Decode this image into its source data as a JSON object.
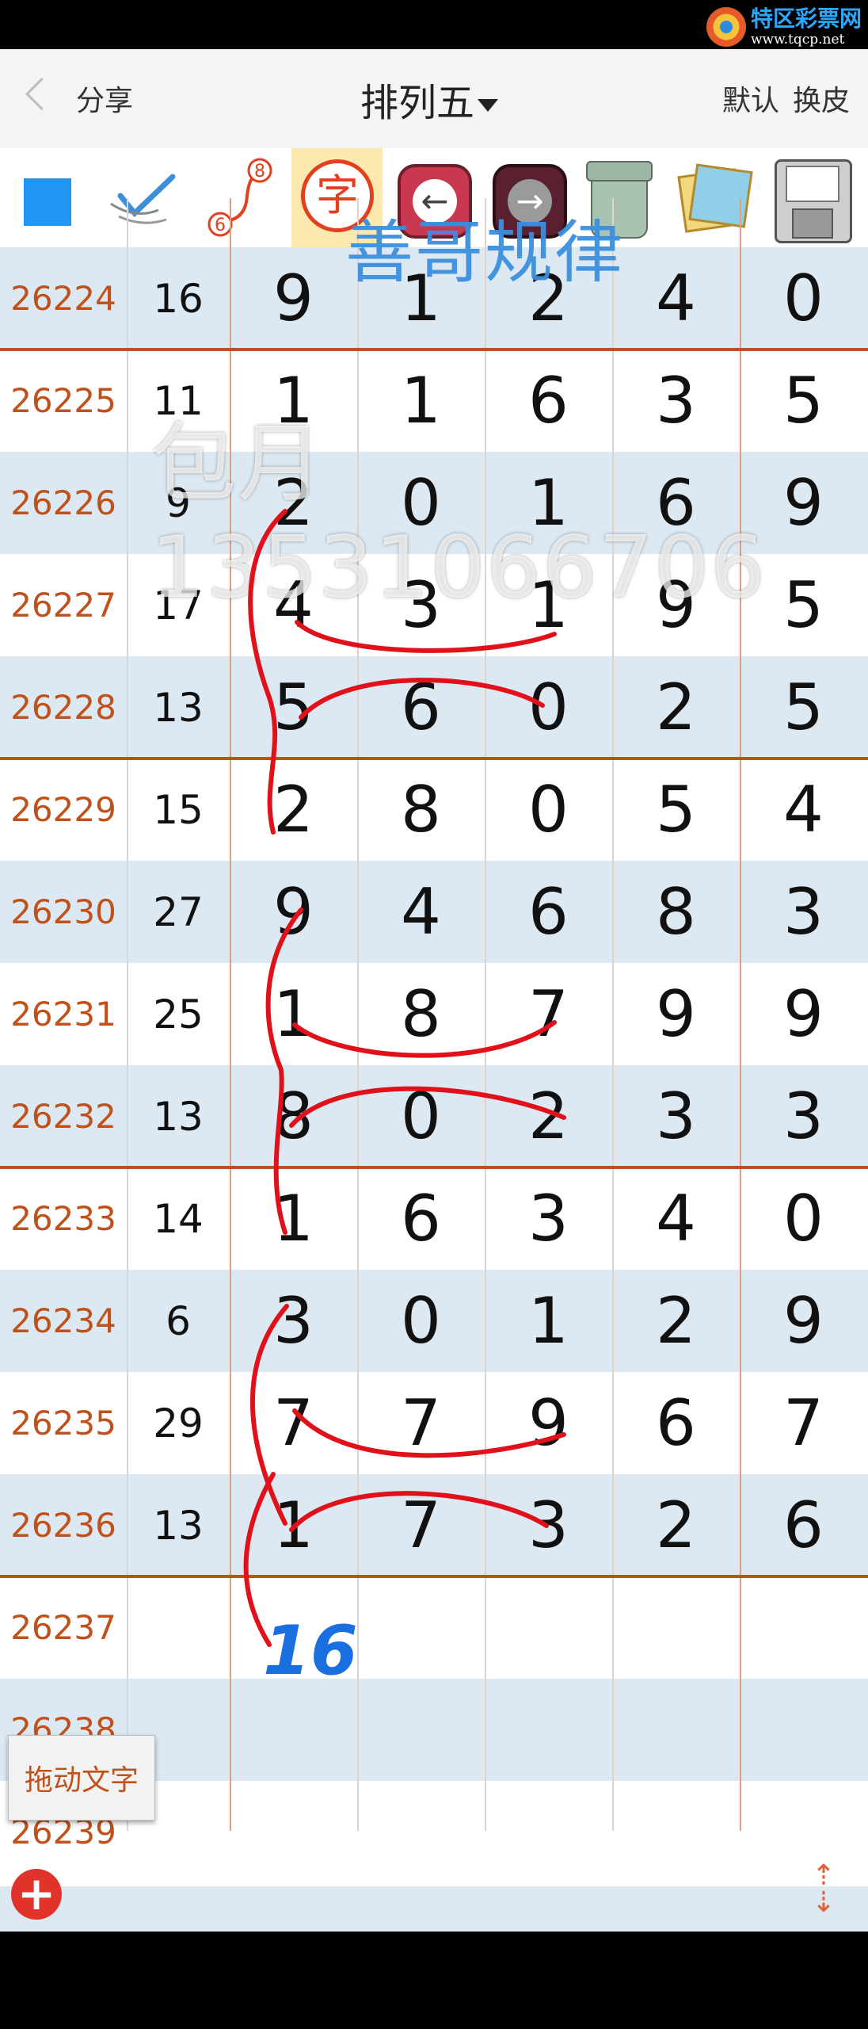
{
  "statusbar": {
    "logo_text": "特区彩票网",
    "logo_url": "www.tqcp.net"
  },
  "header": {
    "back_icon": "chevron-left-icon",
    "share": "分享",
    "title": "排列五",
    "default": "默认",
    "skin": "换皮"
  },
  "toolbar": {
    "icons": [
      "blue-square-icon",
      "pen-check-icon",
      "number-curve-icon",
      "char-stamp-icon",
      "undo-arrow-icon",
      "redo-arrow-icon",
      "trash-icon",
      "photos-icon",
      "floppy-save-icon"
    ],
    "char_label": "字",
    "curve_top": "8",
    "curve_bottom": "6"
  },
  "table": {
    "rows": [
      {
        "issue": "26224",
        "sum": "16",
        "digits": [
          "9",
          "1",
          "2",
          "4",
          "0"
        ]
      },
      {
        "issue": "26225",
        "sum": "11",
        "digits": [
          "1",
          "1",
          "6",
          "3",
          "5"
        ]
      },
      {
        "issue": "26226",
        "sum": "9",
        "digits": [
          "2",
          "0",
          "1",
          "6",
          "9"
        ]
      },
      {
        "issue": "26227",
        "sum": "17",
        "digits": [
          "4",
          "3",
          "1",
          "9",
          "5"
        ]
      },
      {
        "issue": "26228",
        "sum": "13",
        "digits": [
          "5",
          "6",
          "0",
          "2",
          "5"
        ]
      },
      {
        "issue": "26229",
        "sum": "15",
        "digits": [
          "2",
          "8",
          "0",
          "5",
          "4"
        ]
      },
      {
        "issue": "26230",
        "sum": "27",
        "digits": [
          "9",
          "4",
          "6",
          "8",
          "3"
        ]
      },
      {
        "issue": "26231",
        "sum": "25",
        "digits": [
          "1",
          "8",
          "7",
          "9",
          "9"
        ]
      },
      {
        "issue": "26232",
        "sum": "13",
        "digits": [
          "8",
          "0",
          "2",
          "3",
          "3"
        ]
      },
      {
        "issue": "26233",
        "sum": "14",
        "digits": [
          "1",
          "6",
          "3",
          "4",
          "0"
        ]
      },
      {
        "issue": "26234",
        "sum": "6",
        "digits": [
          "3",
          "0",
          "1",
          "2",
          "9"
        ]
      },
      {
        "issue": "26235",
        "sum": "29",
        "digits": [
          "7",
          "7",
          "9",
          "6",
          "7"
        ]
      },
      {
        "issue": "26236",
        "sum": "13",
        "digits": [
          "1",
          "7",
          "3",
          "2",
          "6"
        ]
      },
      {
        "issue": "26237",
        "sum": "",
        "digits": [
          "",
          "",
          "",
          "",
          ""
        ]
      },
      {
        "issue": "26238",
        "sum": "",
        "digits": [
          "",
          "",
          "",
          "",
          ""
        ]
      },
      {
        "issue": "26239",
        "sum": "",
        "digits": [
          "",
          "",
          "",
          "",
          ""
        ]
      }
    ]
  },
  "overlay": {
    "title": "善哥规律",
    "watermark": "包月13531066706",
    "handwritten_number": "16"
  },
  "buttons": {
    "drag_text": "拖动文字",
    "add_icon": "plus-circle-icon",
    "resize_icon": "resize-vertical-icon"
  },
  "colors": {
    "accent": "#c0511a",
    "row_alt": "#dde9f2",
    "title_blue": "#3b8fde",
    "ink_red": "#e0111a",
    "ink_blue": "#1a6fe0"
  }
}
